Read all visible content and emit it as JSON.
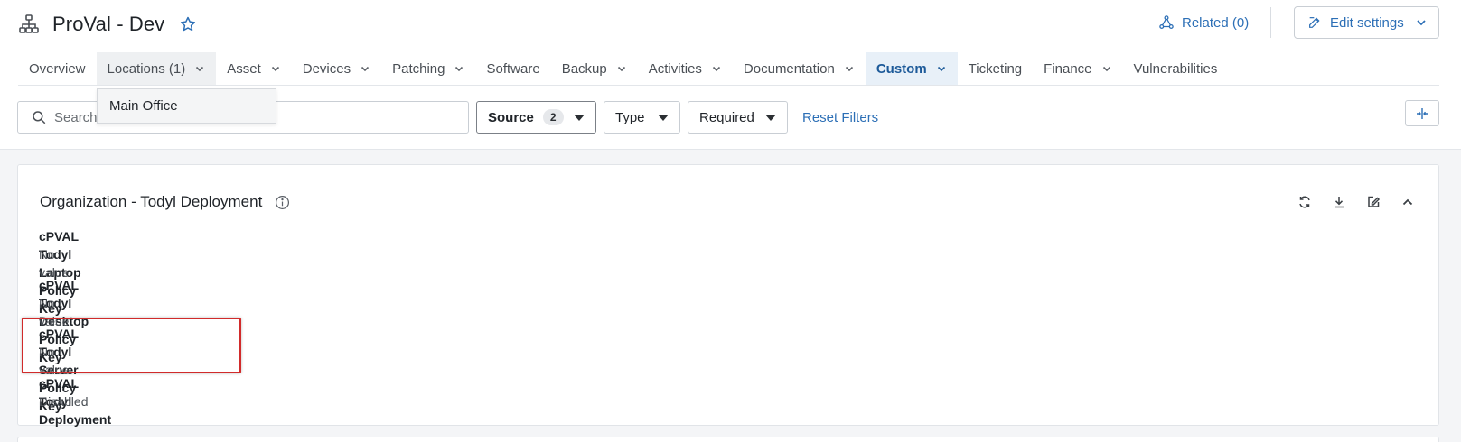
{
  "header": {
    "title": "ProVal - Dev",
    "related_label": "Related (0)",
    "edit_label": "Edit settings"
  },
  "tabs": [
    {
      "label": "Overview",
      "dropdown": false
    },
    {
      "label": "Locations (1)",
      "dropdown": true
    },
    {
      "label": "Asset",
      "dropdown": true
    },
    {
      "label": "Devices",
      "dropdown": true
    },
    {
      "label": "Patching",
      "dropdown": true
    },
    {
      "label": "Software",
      "dropdown": false
    },
    {
      "label": "Backup",
      "dropdown": true
    },
    {
      "label": "Activities",
      "dropdown": true
    },
    {
      "label": "Documentation",
      "dropdown": true
    },
    {
      "label": "Custom",
      "dropdown": true
    },
    {
      "label": "Ticketing",
      "dropdown": false
    },
    {
      "label": "Finance",
      "dropdown": true
    },
    {
      "label": "Vulnerabilities",
      "dropdown": false
    }
  ],
  "locations_menu": {
    "items": [
      "Main Office"
    ]
  },
  "filters": {
    "search_placeholder": "Search",
    "source_label": "Source",
    "source_count": "2",
    "type_label": "Type",
    "required_label": "Required",
    "reset_label": "Reset Filters"
  },
  "card": {
    "title": "Organization - Todyl Deployment",
    "fields": [
      {
        "label": "cPVAL Todyl Laptop Policy Key",
        "value": "No value"
      },
      {
        "label": "cPVAL Todyl Desktop Policy Key",
        "value": "No value"
      },
      {
        "label": "cPVAL Todyl Server Policy Key",
        "value": "No value"
      },
      {
        "label": "cPVAL Todyl Deployment",
        "value": "Disabled"
      }
    ]
  },
  "colors": {
    "accent": "#2c6fb6",
    "active_tab_bg": "#e8f0f8",
    "highlight_border": "#d12b2b",
    "content_bg": "#f4f5f7"
  },
  "icons": {
    "title": "organization-icon",
    "favorite": "star-icon",
    "related": "related-icon",
    "edit": "pencil-icon",
    "search": "search-icon",
    "info": "info-icon",
    "actions": [
      "refresh-icon",
      "download-icon",
      "edit-icon",
      "chevron-up-icon"
    ],
    "collapse": "collapse-columns-icon"
  }
}
